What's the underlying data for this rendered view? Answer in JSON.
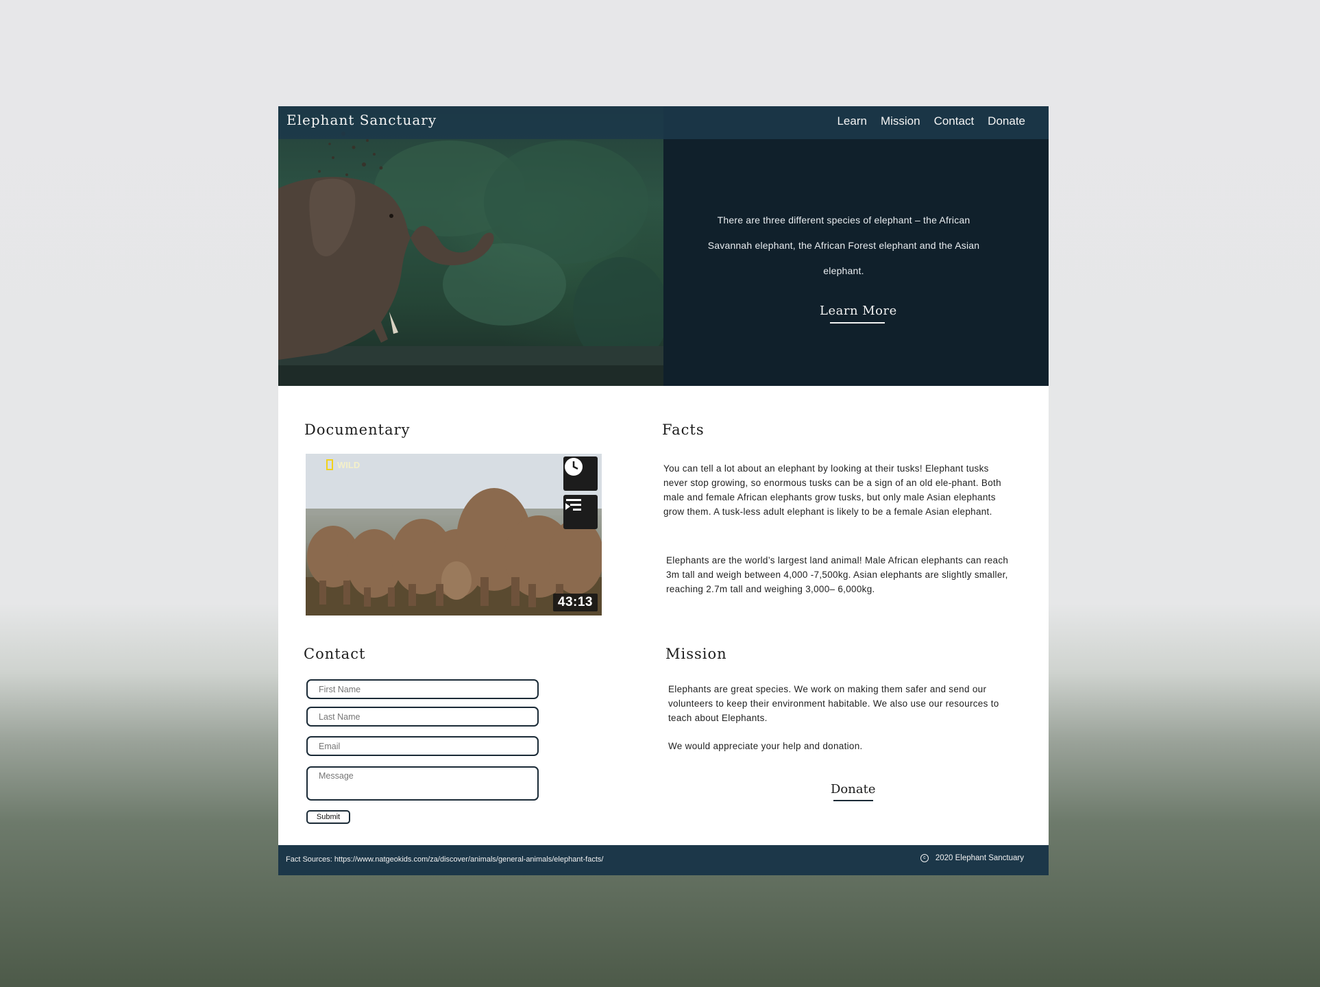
{
  "header": {
    "brand": "Elephant Sanctuary",
    "nav": [
      "Learn",
      "Mission",
      "Contact",
      "Donate"
    ]
  },
  "hero": {
    "text": "There are three different species of elephant – the African Savannah elephant, the African Forest elephant and the Asian elephant.",
    "cta": "Learn More"
  },
  "documentary": {
    "title": "Documentary",
    "video": {
      "logo": "WILD",
      "duration": "43:13",
      "icons": [
        "watch-later-icon",
        "add-to-queue-icon"
      ]
    }
  },
  "facts": {
    "title": "Facts",
    "p1": "You can tell a lot about an elephant by looking at their tusks! Elephant tusks never stop growing, so enormous tusks can be a sign of an old ele-phant. Both male and female African elephants grow tusks, but only male Asian elephants grow them. A tusk-less adult elephant is likely to be a female Asian elephant.",
    "p2": "Elephants are the world’s largest land animal! Male African elephants can reach 3m tall and weigh between 4,000 -7,500kg. Asian elephants are slightly smaller, reaching 2.7m tall and weighing 3,000– 6,000kg."
  },
  "contact": {
    "title": "Contact",
    "fields": {
      "first_name": "First Name",
      "last_name": "Last Name",
      "email": "Email",
      "message": "Message"
    },
    "submit": "Submit"
  },
  "mission": {
    "title": "Mission",
    "p1": "Elephants are great species. We work on making them safer and send our volunteers to keep their environment habitable. We also use our resources to teach about Elephants.",
    "p2": "We would appreciate your help and donation.",
    "donate": "Donate"
  },
  "footer": {
    "sources": "Fact Sources: https://www.natgeokids.com/za/discover/animals/general-animals/elephant-facts/",
    "copyright": "2020 Elephant Sanctuary"
  },
  "colors": {
    "header": "#1a3546",
    "hero_panel": "#10202b",
    "footer": "#1c3749"
  }
}
